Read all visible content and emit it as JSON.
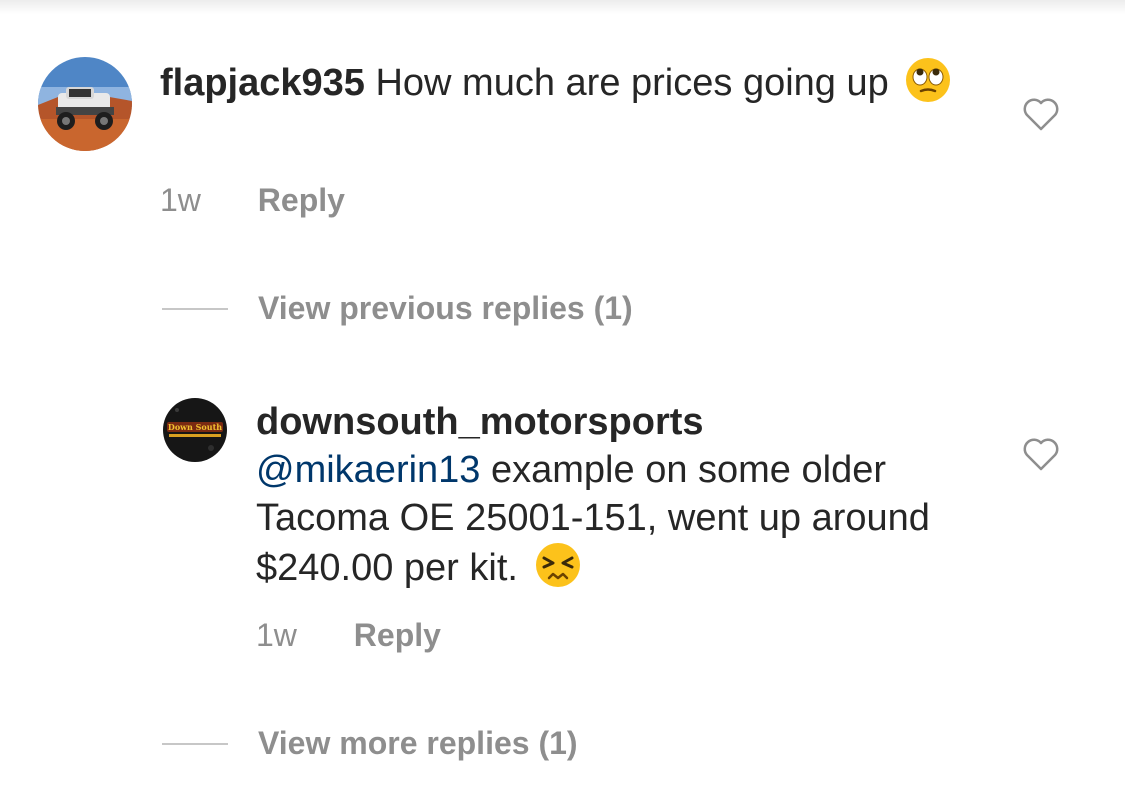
{
  "comment": {
    "username": "flapjack935",
    "text": "How much are prices going up",
    "emoji": "face-with-rolling-eyes",
    "time": "1w",
    "reply_label": "Reply"
  },
  "view_previous": {
    "label": "View previous replies (1)"
  },
  "reply": {
    "username": "downsouth_motorsports",
    "mention": "@mikaerin13",
    "text": "example on some older Tacoma OE 25001-151, went up around $240.00 per kit.",
    "emoji": "persevering-face",
    "time": "1w",
    "reply_label": "Reply",
    "avatar_logo_text": "Down South"
  },
  "view_more": {
    "label": "View more replies (1)"
  },
  "colors": {
    "text": "#262626",
    "muted": "#8e8e8e",
    "mention": "#00376b",
    "divider": "#c7c7c7"
  }
}
